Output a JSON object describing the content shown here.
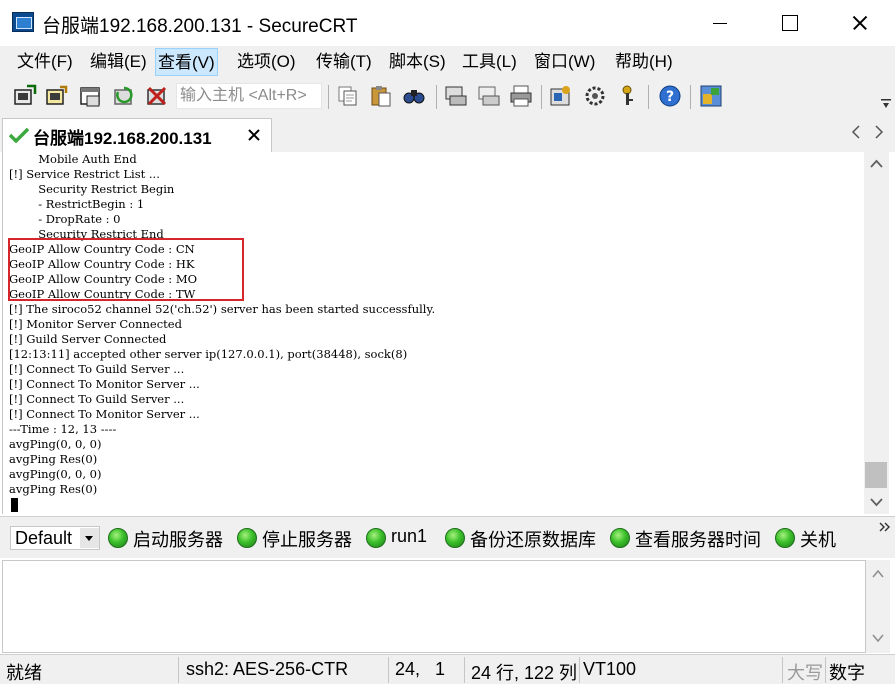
{
  "window": {
    "title": "台服端192.168.200.131 - SecureCRT"
  },
  "menu": {
    "items": [
      "文件(F)",
      "编辑(E)",
      "查看(V)",
      "选项(O)",
      "传输(T)",
      "脚本(S)",
      "工具(L)",
      "窗口(W)",
      "帮助(H)"
    ],
    "active_index": 2
  },
  "toolbar": {
    "quick_connect_placeholder": "输入主机 <Alt+R>"
  },
  "tab": {
    "label": "台服端192.168.200.131"
  },
  "terminal": {
    "lines": [
      "        Mobile Auth End",
      "[!] Service Restrict List ...",
      "        Security Restrict Begin",
      "        - RestrictBegin : 1",
      "        - DropRate : 0",
      "        Security Restrict End",
      "GeoIP Allow Country Code : CN",
      "GeoIP Allow Country Code : HK",
      "GeoIP Allow Country Code : MO",
      "GeoIP Allow Country Code : TW",
      "[!] The siroco52 channel 52('ch.52') server has been started successfully.",
      "[!] Monitor Server Connected",
      "[!] Guild Server Connected",
      "[12:13:11] accepted other server ip(127.0.0.1), port(38448), sock(8)",
      "[!] Connect To Guild Server ...",
      "[!] Connect To Monitor Server ...",
      "[!] Connect To Guild Server ...",
      "[!] Connect To Monitor Server ...",
      "---Time : 12, 13 ----",
      "avgPing(0, 0, 0)",
      "avgPing Res(0)",
      "avgPing(0, 0, 0)",
      "avgPing Res(0)"
    ],
    "highlight_color": "#d6262b"
  },
  "button_bar": {
    "session_select": "Default",
    "buttons": [
      "启动服务器",
      "停止服务器",
      "run1",
      "备份还原数据库",
      "查看服务器时间",
      "关机"
    ]
  },
  "status": {
    "ready": "就绪",
    "protocol": "ssh2: AES-256-CTR",
    "cursor_pos": "24,   1",
    "size": "24 行, 122 列",
    "term_type": "VT100",
    "caps": "大写",
    "num": "数字"
  }
}
